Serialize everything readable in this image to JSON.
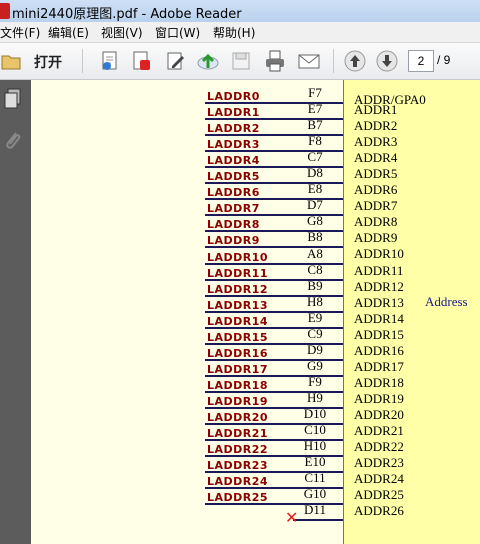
{
  "window": {
    "title": "mini2440原理图.pdf - Adobe Reader"
  },
  "menu": [
    "文件(F)",
    "编辑(E)",
    "视图(V)",
    "窗口(W)",
    "帮助(H)"
  ],
  "toolbar": {
    "open_label": "打开",
    "page_current": "2",
    "page_total": "/ 9",
    "icons": [
      "folder-open-icon",
      "create-pdf-icon",
      "export-icon",
      "sign-icon",
      "upload-icon",
      "save-icon",
      "print-icon",
      "email-icon",
      "prev-page-icon",
      "next-page-icon"
    ]
  },
  "nav": {
    "icons": [
      "pages-icon",
      "attachments-icon"
    ]
  },
  "schematic": {
    "group_label": "Address",
    "top_pin_name": "ADDR/GPA0",
    "pins": [
      {
        "net": "LADDR0",
        "pin": "F7",
        "name": "ADDR1"
      },
      {
        "net": "LADDR1",
        "pin": "E7",
        "name": "ADDR2"
      },
      {
        "net": "LADDR2",
        "pin": "B7",
        "name": "ADDR3"
      },
      {
        "net": "LADDR3",
        "pin": "F8",
        "name": "ADDR4"
      },
      {
        "net": "LADDR4",
        "pin": "C7",
        "name": "ADDR5"
      },
      {
        "net": "LADDR5",
        "pin": "D8",
        "name": "ADDR6"
      },
      {
        "net": "LADDR6",
        "pin": "E8",
        "name": "ADDR7"
      },
      {
        "net": "LADDR7",
        "pin": "D7",
        "name": "ADDR8"
      },
      {
        "net": "LADDR8",
        "pin": "G8",
        "name": "ADDR9"
      },
      {
        "net": "LADDR9",
        "pin": "B8",
        "name": "ADDR10"
      },
      {
        "net": "LADDR10",
        "pin": "A8",
        "name": "ADDR11"
      },
      {
        "net": "LADDR11",
        "pin": "C8",
        "name": "ADDR12"
      },
      {
        "net": "LADDR12",
        "pin": "B9",
        "name": "ADDR13"
      },
      {
        "net": "LADDR13",
        "pin": "H8",
        "name": "ADDR14"
      },
      {
        "net": "LADDR14",
        "pin": "E9",
        "name": "ADDR15"
      },
      {
        "net": "LADDR15",
        "pin": "C9",
        "name": "ADDR16"
      },
      {
        "net": "LADDR16",
        "pin": "D9",
        "name": "ADDR17"
      },
      {
        "net": "LADDR17",
        "pin": "G9",
        "name": "ADDR18"
      },
      {
        "net": "LADDR18",
        "pin": "F9",
        "name": "ADDR19"
      },
      {
        "net": "LADDR19",
        "pin": "H9",
        "name": "ADDR20"
      },
      {
        "net": "LADDR20",
        "pin": "D10",
        "name": "ADDR21"
      },
      {
        "net": "LADDR21",
        "pin": "C10",
        "name": "ADDR22"
      },
      {
        "net": "LADDR22",
        "pin": "H10",
        "name": "ADDR23"
      },
      {
        "net": "LADDR23",
        "pin": "E10",
        "name": "ADDR24"
      },
      {
        "net": "LADDR24",
        "pin": "C11",
        "name": "ADDR25"
      },
      {
        "net": "LADDR25",
        "pin": "G10",
        "name": "ADDR26"
      },
      {
        "net": "",
        "pin": "D11",
        "name": ""
      }
    ]
  },
  "colors": {
    "net": "#8b0000",
    "chip": "#ffffa8",
    "paper": "#ffffe8",
    "nc_mark": "#e02020"
  }
}
